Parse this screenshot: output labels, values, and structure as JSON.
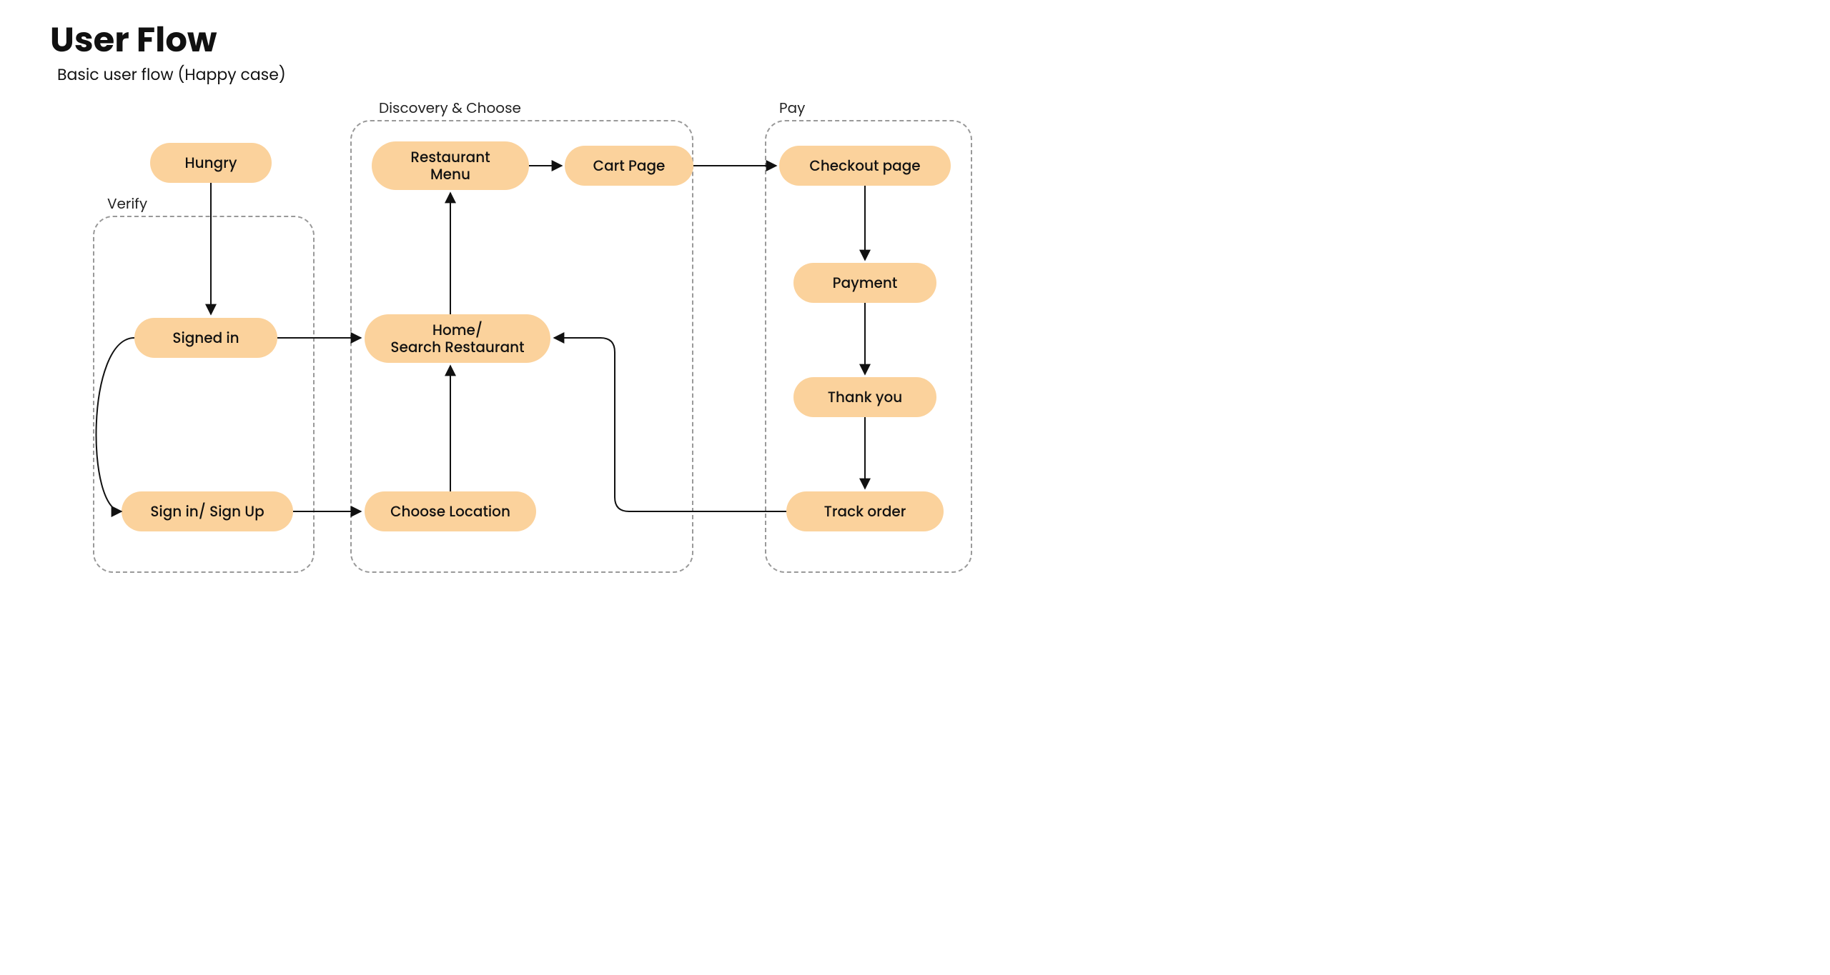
{
  "title": "User Flow",
  "subtitle": "Basic user flow (Happy case)",
  "groups": {
    "verify": {
      "label": "Verify"
    },
    "discover": {
      "label": "Discovery & Choose"
    },
    "pay": {
      "label": "Pay"
    }
  },
  "nodes": {
    "hungry": {
      "label": "Hungry"
    },
    "signed_in": {
      "label": "Signed in"
    },
    "sign_in_up": {
      "label": "Sign in/ Sign Up"
    },
    "restaurant_menu": {
      "label": "Restaurant\nMenu"
    },
    "home_search": {
      "label": "Home/\nSearch Restaurant"
    },
    "choose_location": {
      "label": "Choose Location"
    },
    "cart": {
      "label": "Cart Page"
    },
    "checkout": {
      "label": "Checkout page"
    },
    "payment": {
      "label": "Payment"
    },
    "thank_you": {
      "label": "Thank you"
    },
    "track_order": {
      "label": "Track order"
    }
  },
  "colors": {
    "node_fill": "#fbd29c",
    "dashed_border": "#999999",
    "arrow": "#111111"
  },
  "edges": [
    [
      "hungry",
      "signed_in"
    ],
    [
      "signed_in",
      "sign_in_up"
    ],
    [
      "signed_in",
      "home_search"
    ],
    [
      "sign_in_up",
      "choose_location"
    ],
    [
      "choose_location",
      "home_search"
    ],
    [
      "home_search",
      "restaurant_menu"
    ],
    [
      "restaurant_menu",
      "cart"
    ],
    [
      "cart",
      "checkout"
    ],
    [
      "checkout",
      "payment"
    ],
    [
      "payment",
      "thank_you"
    ],
    [
      "thank_you",
      "track_order"
    ],
    [
      "track_order",
      "home_search"
    ]
  ]
}
